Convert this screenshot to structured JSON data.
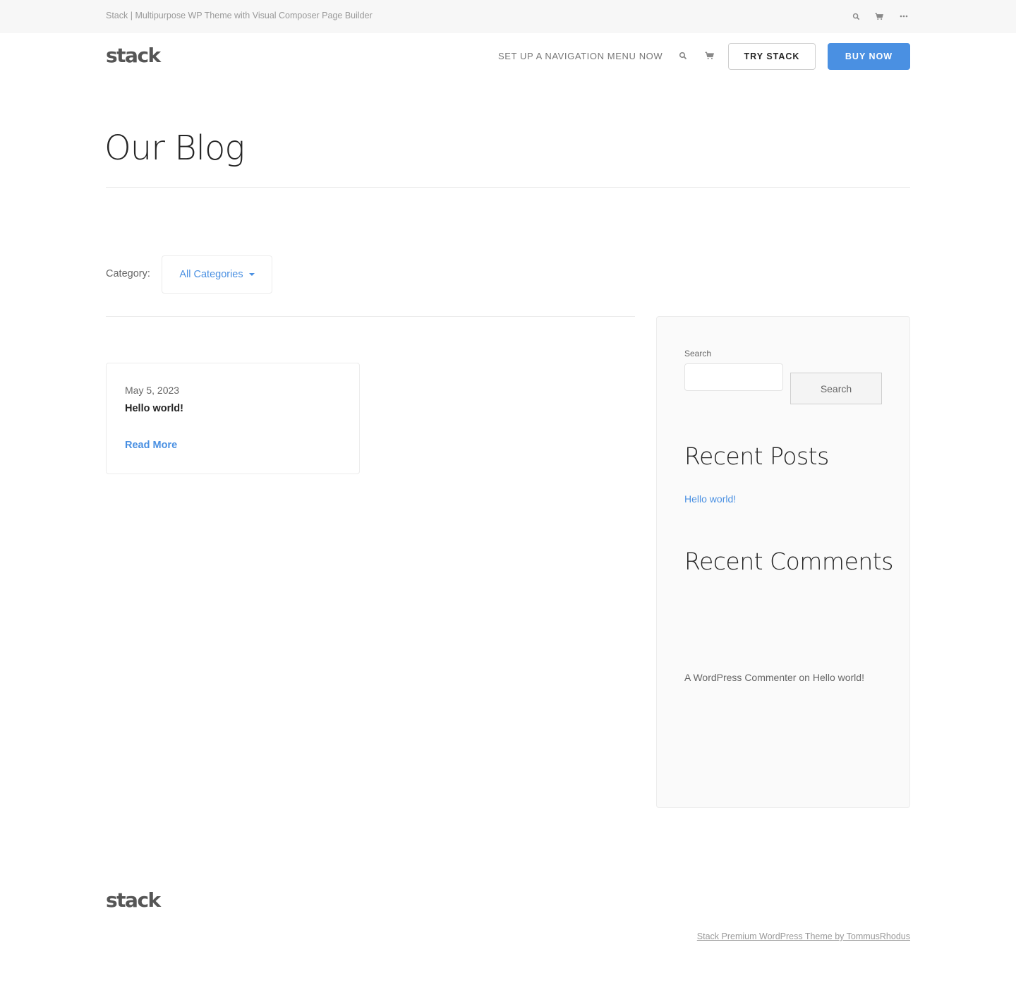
{
  "topbar": {
    "site_title": "Stack | Multipurpose WP Theme with Visual Composer Page Builder",
    "icons": [
      "search-icon",
      "cart-icon",
      "more-dots-icon"
    ]
  },
  "nav": {
    "logo": "stack",
    "menu_link": "SET UP A NAVIGATION MENU NOW",
    "try_button": "TRY STACK",
    "buy_button": "BUY NOW",
    "accent_color": "#4a90e2"
  },
  "page": {
    "title": "Our Blog"
  },
  "filter": {
    "label": "Category:",
    "selected": "All Categories"
  },
  "posts": [
    {
      "date": "May 5, 2023",
      "title": "Hello world!",
      "read_more": "Read More"
    }
  ],
  "sidebar": {
    "search_label": "Search",
    "search_value": "",
    "search_button": "Search",
    "recent_posts_heading": "Recent Posts",
    "recent_posts": [
      "Hello world!"
    ],
    "recent_comments_heading": "Recent Comments",
    "recent_comment": {
      "author": "A WordPress Commenter",
      "on": "on",
      "post": "Hello world!"
    }
  },
  "footer": {
    "logo": "stack",
    "credit": "Stack Premium WordPress Theme by TommusRhodus"
  }
}
